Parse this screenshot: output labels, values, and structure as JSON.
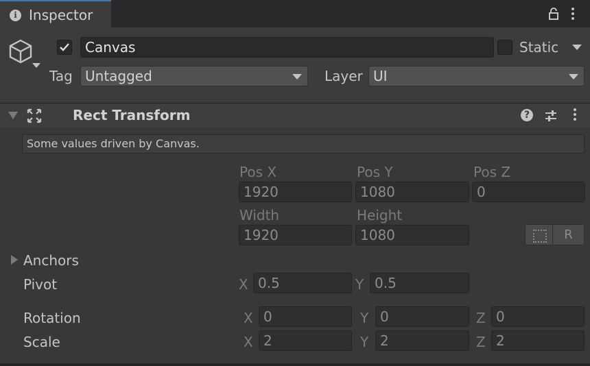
{
  "tab": {
    "title": "Inspector",
    "icon": "info-icon"
  },
  "header": {
    "object_name": "Canvas",
    "active_checked": true,
    "static_label": "Static",
    "tag_label": "Tag",
    "tag_value": "Untagged",
    "layer_label": "Layer",
    "layer_value": "UI"
  },
  "component": {
    "title": "Rect Transform",
    "help_icon": "?",
    "info_message": "Some values driven by Canvas.",
    "columns": {
      "pos_x": "Pos X",
      "pos_y": "Pos Y",
      "pos_z": "Pos Z",
      "width": "Width",
      "height": "Height"
    },
    "values": {
      "pos_x": "1920",
      "pos_y": "1080",
      "pos_z": "0",
      "width": "1920",
      "height": "1080"
    },
    "raw_button": "R",
    "anchors_label": "Anchors",
    "pivot": {
      "label": "Pivot",
      "x_axis": "X",
      "x": "0.5",
      "y_axis": "Y",
      "y": "0.5"
    },
    "rotation": {
      "label": "Rotation",
      "x_axis": "X",
      "x": "0",
      "y_axis": "Y",
      "y": "0",
      "z_axis": "Z",
      "z": "0"
    },
    "scale": {
      "label": "Scale",
      "x_axis": "X",
      "x": "2",
      "y_axis": "Y",
      "y": "2",
      "z_axis": "Z",
      "z": "2"
    }
  },
  "colors": {
    "background": "#383838",
    "field": "#2a2a2a",
    "tab_accent": "#3a79bb",
    "text": "#c4c4c4"
  }
}
